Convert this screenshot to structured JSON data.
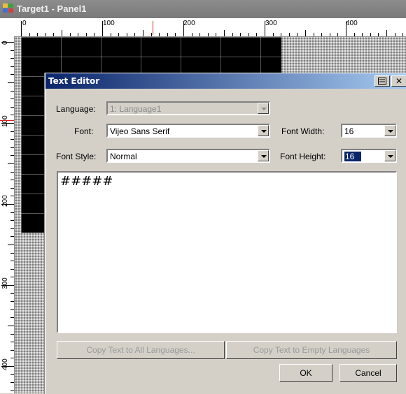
{
  "window": {
    "title": "Target1 - Panel1"
  },
  "ruler": {
    "h_labels": [
      "0",
      "100",
      "200",
      "300",
      "400"
    ],
    "v_labels": [
      "0",
      "100",
      "200",
      "300",
      "400"
    ]
  },
  "dialog": {
    "title": "Text Editor",
    "language_label": "Language:",
    "language_value": "1: Language1",
    "font_label": "Font:",
    "font_value": "Vijeo Sans Serif",
    "font_width_label": "Font Width:",
    "font_width_value": "16",
    "font_style_label": "Font Style:",
    "font_style_value": "Normal",
    "font_height_label": "Font Height:",
    "font_height_value": "16",
    "text_content": "#####",
    "copy_all_label": "Copy Text to All Languages...",
    "copy_empty_label": "Copy Text to Empty Languages",
    "ok_label": "OK",
    "cancel_label": "Cancel"
  },
  "colors": {
    "titlebar_start": "#0a246a",
    "titlebar_end": "#a6caf0",
    "face": "#d4d0c8"
  }
}
